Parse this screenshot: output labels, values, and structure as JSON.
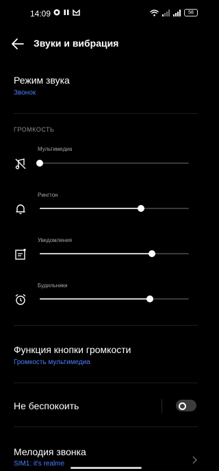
{
  "status": {
    "time": "14:09",
    "battery": "58"
  },
  "header": {
    "title": "Звуки и вибрация"
  },
  "sound_mode": {
    "title": "Режим звука",
    "value": "Звонок"
  },
  "volume": {
    "header": "ГРОМКОСТЬ",
    "sliders": [
      {
        "label": "Мультимедиа",
        "level": 0.0,
        "icon": "music-off-icon"
      },
      {
        "label": "Рингтон",
        "level": 0.68,
        "icon": "bell-icon"
      },
      {
        "label": "Уведомления",
        "level": 0.75,
        "icon": "notification-icon"
      },
      {
        "label": "Будильники",
        "level": 0.74,
        "icon": "alarm-clock-icon"
      }
    ]
  },
  "volume_button": {
    "title": "Функция кнопки громкости",
    "value": "Громкость мультимедиа"
  },
  "dnd": {
    "title": "Не беспокоить",
    "enabled": false
  },
  "ringtone": {
    "title": "Мелодия звонка",
    "value": "SIM1: it's realme"
  },
  "colors": {
    "accent": "#4a7dff",
    "background": "#000000"
  }
}
